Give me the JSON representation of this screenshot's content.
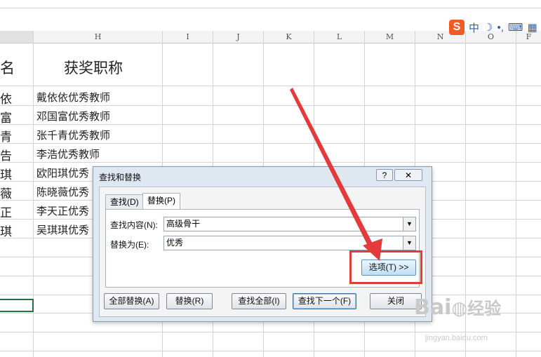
{
  "columns": [
    "H",
    "I",
    "J",
    "K",
    "L",
    "M",
    "N",
    "O",
    "F"
  ],
  "header_cells": {
    "left": "名",
    "right": "获奖职称"
  },
  "rows": [
    {
      "left": "依",
      "right": "戴依依优秀教师"
    },
    {
      "left": "富",
      "right": "邓国富优秀教师"
    },
    {
      "left": "青",
      "right": "张千青优秀教师"
    },
    {
      "left": "告",
      "right": "李浩优秀教师"
    },
    {
      "left": "琪",
      "right": "欧阳琪优秀"
    },
    {
      "left": "薇",
      "right": "陈晓薇优秀"
    },
    {
      "left": "正",
      "right": "李天正优秀"
    },
    {
      "left": "琪",
      "right": "吴琪琪优秀"
    }
  ],
  "ime": {
    "logo": "S",
    "mode": "中"
  },
  "dialog": {
    "title": "查找和替换",
    "help": "?",
    "tabs": [
      "查找(D)",
      "替换(P)"
    ],
    "find_label": "查找内容(N):",
    "find_value": "高级骨干",
    "replace_label": "替换为(E):",
    "replace_value": "优秀",
    "options_btn": "选项(T) >>",
    "buttons": {
      "replace_all": "全部替换(A)",
      "replace": "替换(R)",
      "find_all": "查找全部(I)",
      "find_next": "查找下一个(F)",
      "close": "关闭"
    }
  },
  "watermark": {
    "brand": "Bai",
    "brand2": "经验",
    "url": "jingyan.baidu.com"
  },
  "colors": {
    "arrow": "#e33b3b",
    "selection": "#217346"
  }
}
